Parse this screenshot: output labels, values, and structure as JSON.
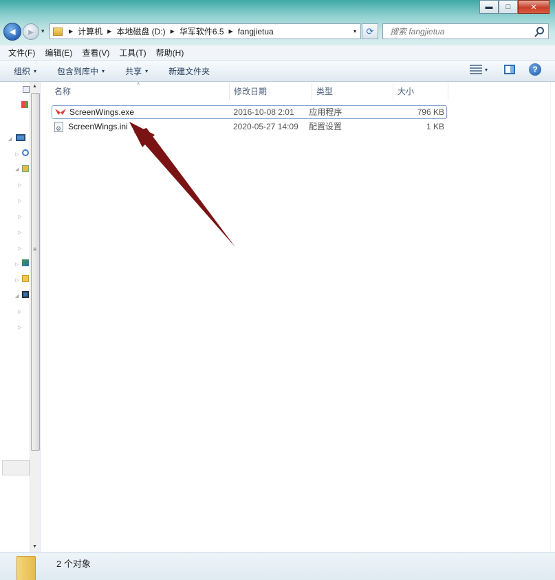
{
  "window": {
    "minimize_icon": "minimize-icon",
    "maximize_icon": "maximize-icon",
    "close_icon": "close-icon",
    "minimize_glyph": "▬",
    "maximize_glyph": "□",
    "close_glyph": "✕"
  },
  "nav": {
    "back_glyph": "◄",
    "forward_glyph": "►",
    "history_glyph": "▾"
  },
  "address": {
    "crumbs": [
      "计算机",
      "本地磁盘 (D:)",
      "华军软件6.5",
      "fangjietua"
    ],
    "separator_glyph": "▶",
    "dropdown_glyph": "▾",
    "refresh_glyph": "⟳"
  },
  "search": {
    "placeholder": "搜索 fangjietua"
  },
  "menubar": [
    "文件(F)",
    "编辑(E)",
    "查看(V)",
    "工具(T)",
    "帮助(H)"
  ],
  "toolbar": {
    "organize": "组织",
    "include_library": "包含到库中",
    "share": "共享",
    "new_folder": "新建文件夹",
    "caret_glyph": "▾",
    "help_glyph": "?"
  },
  "columns": [
    "名称",
    "修改日期",
    "类型",
    "大小"
  ],
  "sort_glyph": "˄",
  "files": [
    {
      "name": "ScreenWings.exe",
      "modified": "2016-10-08 2:01",
      "type": "应用程序",
      "size": "796 KB",
      "icon": "screenwings-app-icon"
    },
    {
      "name": "ScreenWings.ini",
      "modified": "2020-05-27 14:09",
      "type": "配置设置",
      "size": "1 KB",
      "icon": "config-file-icon"
    }
  ],
  "status": {
    "count_text": "2 个对象"
  },
  "colors": {
    "annotation_arrow": "#7a1414",
    "selection_border": "#7da2ce"
  }
}
